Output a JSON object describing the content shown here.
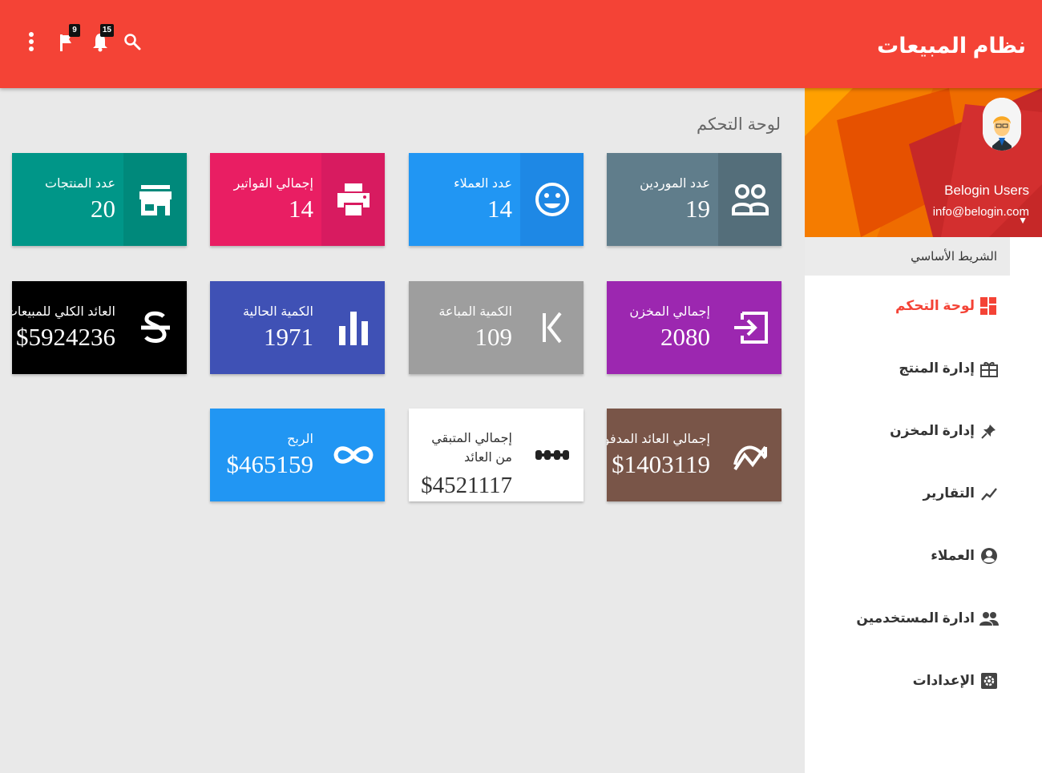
{
  "app": {
    "title": "نظام المبيعات"
  },
  "topbar": {
    "flag_badge": "9",
    "bell_badge": "15",
    "icons": [
      "more-vert-icon",
      "flag-icon",
      "bell-icon",
      "search-icon"
    ]
  },
  "sidebar": {
    "user": {
      "name": "Belogin Users",
      "email": "info@belogin.com"
    },
    "section_header": "الشريط الأساسي",
    "items": [
      {
        "label": "لوحة التحكم",
        "icon": "dashboard-icon",
        "active": true
      },
      {
        "label": "إدارة المنتج",
        "icon": "gift-icon",
        "active": false
      },
      {
        "label": "إدارة المخزن",
        "icon": "pin-icon",
        "active": false
      },
      {
        "label": "التقارير",
        "icon": "trend-icon",
        "active": false
      },
      {
        "label": "العملاء",
        "icon": "account-circle-icon",
        "active": false
      },
      {
        "label": "ادارة المستخدمين",
        "icon": "people-icon",
        "active": false
      },
      {
        "label": "الإعدادات",
        "icon": "settings-icon",
        "active": false
      }
    ]
  },
  "main": {
    "title": "لوحة التحكم",
    "cards": [
      {
        "label": "عدد الموردين",
        "value": "19",
        "icon": "group-icon",
        "color": "#607d8b"
      },
      {
        "label": "عدد العملاء",
        "value": "14",
        "icon": "smiley-icon",
        "color": "#2196f3"
      },
      {
        "label": "إجمالي الفواتير",
        "value": "14",
        "icon": "printer-icon",
        "color": "#e91e63"
      },
      {
        "label": "عدد المنتجات",
        "value": "20",
        "icon": "store-icon",
        "color": "#009688"
      },
      {
        "label": "إجمالي المخزن",
        "value": "2080",
        "icon": "login-icon",
        "color": "#9c27b0"
      },
      {
        "label": "الكمية المباعة",
        "value": "109",
        "icon": "page-first-icon",
        "color": "#9e9e9e"
      },
      {
        "label": "الكمية الحالية",
        "value": "1971",
        "icon": "bar-chart-icon",
        "color": "#3f51b5"
      },
      {
        "label": "العائد الكلي للمبيعات",
        "value": "$5924236",
        "icon": "currency-strike-icon",
        "color": "#000000"
      },
      {
        "label": "إجمالي العائد المدفوع",
        "value": "$1403119",
        "icon": "chart-arc-icon",
        "color": "#795548"
      },
      {
        "label": "إجمالي المتبقي من العائد",
        "value": "$4521117",
        "icon": "dumbbell-icon",
        "color": "#ffffff"
      },
      {
        "label": "الربح",
        "value": "$465159",
        "icon": "infinity-icon",
        "color": "#2196f3"
      }
    ]
  }
}
